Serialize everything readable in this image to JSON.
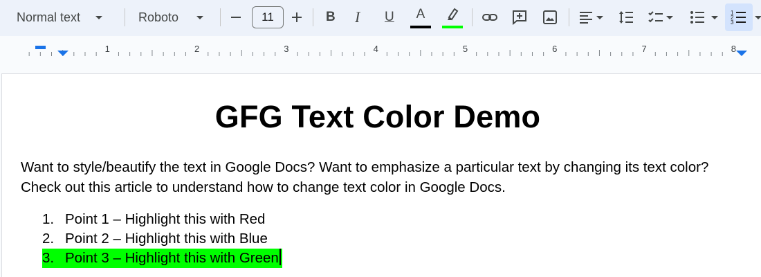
{
  "toolbar": {
    "style_dropdown": "Normal text",
    "font_dropdown": "Roboto",
    "font_size": "11",
    "bold_label": "B",
    "italic_label": "I",
    "underline_label": "U",
    "text_color_label": "A",
    "text_color": "#000000",
    "highlight_color": "#00ff00",
    "icons": [
      "minus-icon",
      "plus-icon",
      "link-icon",
      "add-comment-icon",
      "insert-image-icon",
      "align-left-icon",
      "line-spacing-icon",
      "checklist-icon",
      "bulleted-list-icon",
      "numbered-list-icon",
      "highlighter-icon"
    ]
  },
  "ruler": {
    "labels": [
      "1",
      "2",
      "3",
      "4",
      "5",
      "6",
      "7",
      "8"
    ]
  },
  "document": {
    "title": "GFG Text Color Demo",
    "paragraph": "Want to style/beautify the text in Google Docs? Want to emphasize a particular text by changing its text color? Check out this article to understand how to change text color in Google Docs.",
    "list": [
      {
        "number": "1.",
        "text": "Point 1 – Highlight this with Red",
        "highlight": ""
      },
      {
        "number": "2.",
        "text": "Point 2 – Highlight this with Blue",
        "highlight": ""
      },
      {
        "number": "3.",
        "text": "Point 3 – Highlight this with Green",
        "highlight": "#00ff00"
      }
    ]
  }
}
